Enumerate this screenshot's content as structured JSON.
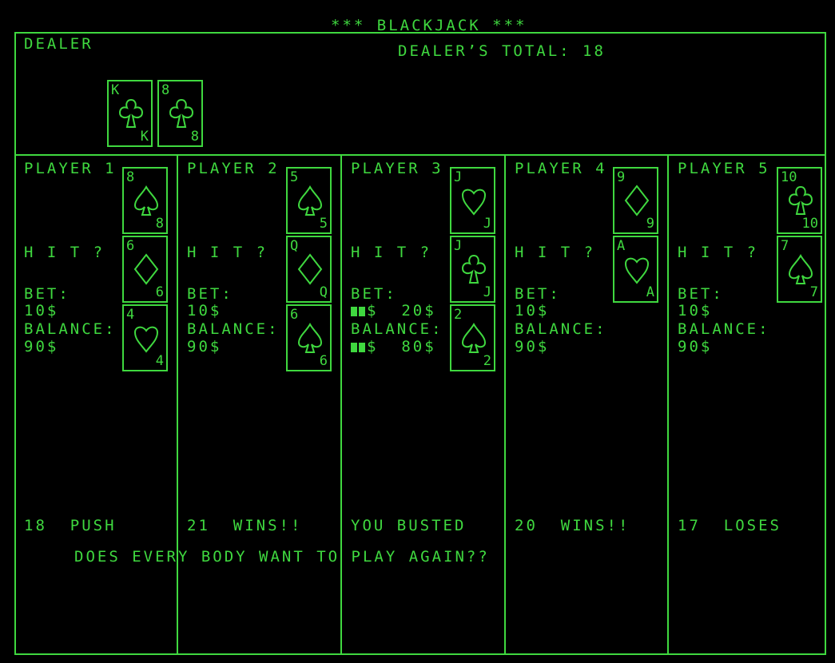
{
  "title": "*** BLACKJACK ***",
  "dealer": {
    "label": "DEALER",
    "total_text": "DEALER’S TOTAL: 18",
    "cards": [
      {
        "rank": "K",
        "suit": "clubs"
      },
      {
        "rank": "8",
        "suit": "clubs"
      }
    ]
  },
  "players": [
    {
      "name": "PLAYER 1",
      "prompt": "H I T ?",
      "bet_label": "BET:",
      "bet": "10$",
      "balance_label": "BALANCE:",
      "balance": "90$",
      "cards": [
        {
          "rank": "8",
          "suit": "spades"
        },
        {
          "rank": "6",
          "suit": "diamonds"
        },
        {
          "rank": "4",
          "suit": "hearts"
        }
      ],
      "result": "18  PUSH"
    },
    {
      "name": "PLAYER 2",
      "prompt": "H I T ?",
      "bet_label": "BET:",
      "bet": "10$",
      "balance_label": "BALANCE:",
      "balance": "90$",
      "cards": [
        {
          "rank": "5",
          "suit": "spades"
        },
        {
          "rank": "Q",
          "suit": "diamonds"
        },
        {
          "rank": "6",
          "suit": "spades"
        }
      ],
      "result": "21  WINS!!"
    },
    {
      "name": "PLAYER 3",
      "prompt": "H I T ?",
      "bet_label": "BET:",
      "bet": "$  20$",
      "balance_label": "BALANCE:",
      "balance": "$  80$",
      "cards": [
        {
          "rank": "J",
          "suit": "hearts"
        },
        {
          "rank": "J",
          "suit": "clubs"
        },
        {
          "rank": "2",
          "suit": "spades"
        }
      ],
      "result": "YOU BUSTED"
    },
    {
      "name": "PLAYER 4",
      "prompt": "H I T ?",
      "bet_label": "BET:",
      "bet": "10$",
      "balance_label": "BALANCE:",
      "balance": "90$",
      "cards": [
        {
          "rank": "9",
          "suit": "diamonds"
        },
        {
          "rank": "A",
          "suit": "hearts"
        }
      ],
      "result": "20  WINS!!"
    },
    {
      "name": "PLAYER 5",
      "prompt": "H I T ?",
      "bet_label": "BET:",
      "bet": "10$",
      "balance_label": "BALANCE:",
      "balance": "90$",
      "cards": [
        {
          "rank": "10",
          "suit": "clubs"
        },
        {
          "rank": "7",
          "suit": "spades"
        }
      ],
      "result": "17  LOSES"
    }
  ],
  "play_again_prompt": "DOES EVERY BODY WANT TO PLAY AGAIN??",
  "colors": {
    "phosphor": "#3fd83f",
    "background": "#000000"
  }
}
